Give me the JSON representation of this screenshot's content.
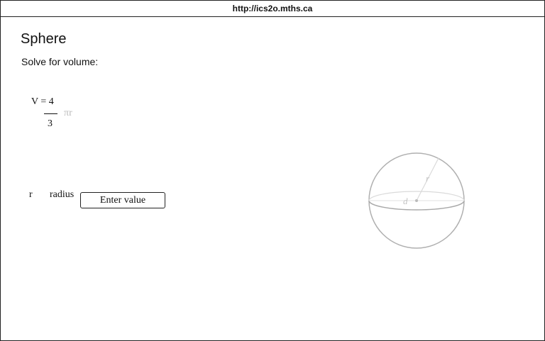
{
  "browser": {
    "url": "http://ics2o.mths.ca"
  },
  "page": {
    "title": "Sphere",
    "prompt": "Solve for volume:"
  },
  "formula": {
    "lhs": "V = 4",
    "denominator": "3",
    "trailing": "πr"
  },
  "variable": {
    "symbol": "r",
    "name": "radius",
    "input_placeholder": "Enter value"
  },
  "diagram": {
    "radius_label": "r",
    "diameter_label": "d",
    "stroke_color": "#b0b0b0"
  }
}
